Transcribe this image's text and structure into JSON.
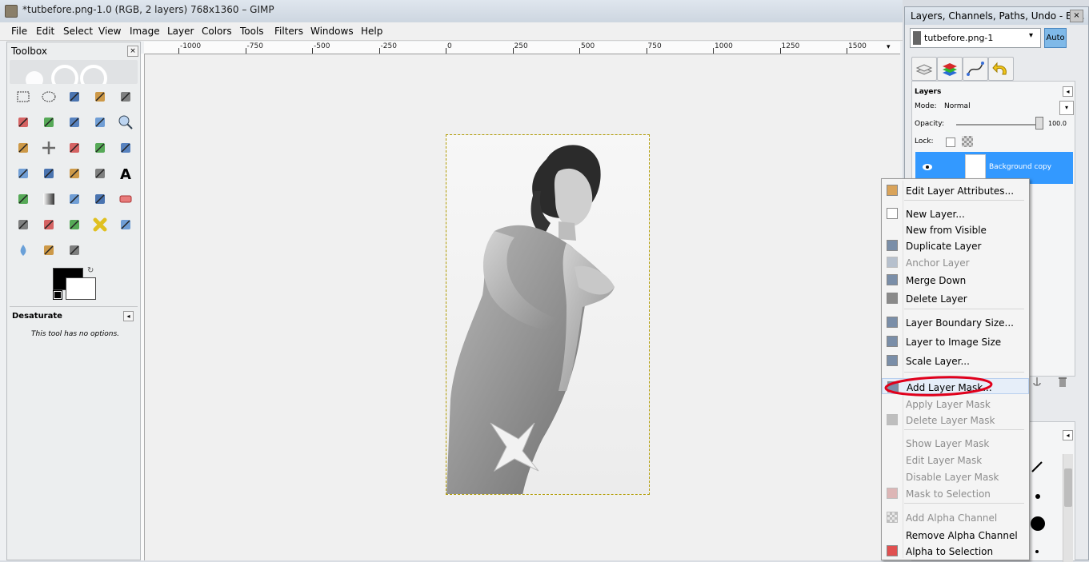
{
  "window": {
    "title": "*tutbefore.png-1.0 (RGB, 2 layers) 768x1360 – GIMP"
  },
  "menubar": [
    "File",
    "Edit",
    "Select",
    "View",
    "Image",
    "Layer",
    "Colors",
    "Tools",
    "Filters",
    "Windows",
    "Help"
  ],
  "toolbox": {
    "title": "Toolbox",
    "close_icon": "×",
    "tools": [
      "rect-select",
      "ellipse-select",
      "free-select",
      "fuzzy-select",
      "select-by-color",
      "scissors",
      "foreground-select",
      "paths",
      "color-picker",
      "zoom",
      "measure",
      "move",
      "align",
      "crop",
      "rotate",
      "scale",
      "shear",
      "perspective",
      "flip",
      "text",
      "bucket-fill",
      "blend",
      "pencil",
      "paintbrush",
      "eraser",
      "airbrush",
      "ink",
      "clone",
      "heal",
      "perspective-clone",
      "blur",
      "smudge",
      "dodge-burn"
    ],
    "fg_color": "#000000",
    "bg_color": "#ffffff",
    "swap_icon": "↻",
    "tool_options_title": "Desaturate",
    "tool_options_note": "This tool has no options.",
    "collapse_icon": "◂"
  },
  "ruler": {
    "labels": [
      "-1000",
      "-750",
      "-500",
      "-250",
      "0",
      "250",
      "500",
      "750",
      "1000",
      "1250",
      "1500"
    ],
    "corner_arrow": "▾"
  },
  "dock": {
    "title": "Layers, Channels, Paths, Undo - Br...",
    "close_icon": "×",
    "image_select": "tutbefore.png-1",
    "image_select_arrow": "▾",
    "auto_label": "Auto",
    "tabs": [
      "layers-tab",
      "channels-tab",
      "paths-tab",
      "undo-tab"
    ],
    "layers": {
      "label": "Layers",
      "collapse_icon": "◂",
      "mode_label": "Mode:",
      "mode_value": "Normal",
      "mode_arrow": "▾",
      "opacity_label": "Opacity:",
      "opacity_value": "100.0",
      "lock_label": "Lock:",
      "layer_name": "Background copy"
    },
    "brushes_collapse": "◂"
  },
  "context_menu": {
    "items": [
      {
        "label": "Edit Layer Attributes...",
        "disabled": false,
        "icon": "edit-attributes-icon"
      },
      {
        "label": "New Layer...",
        "disabled": false,
        "icon": "new-layer-icon"
      },
      {
        "label": "New from Visible",
        "disabled": false,
        "icon": ""
      },
      {
        "label": "Duplicate Layer",
        "disabled": false,
        "icon": "duplicate-layer-icon"
      },
      {
        "label": "Anchor Layer",
        "disabled": true,
        "icon": "anchor-icon"
      },
      {
        "label": "Merge Down",
        "disabled": false,
        "icon": "merge-down-icon"
      },
      {
        "label": "Delete Layer",
        "disabled": false,
        "icon": "delete-layer-icon"
      },
      {
        "label": "Layer Boundary Size...",
        "disabled": false,
        "icon": "boundary-size-icon"
      },
      {
        "label": "Layer to Image Size",
        "disabled": false,
        "icon": "layer-to-image-size-icon"
      },
      {
        "label": "Scale Layer...",
        "disabled": false,
        "icon": "scale-layer-icon"
      },
      {
        "label": "Add Layer Mask...",
        "disabled": false,
        "icon": "add-mask-icon"
      },
      {
        "label": "Apply Layer Mask",
        "disabled": true,
        "icon": ""
      },
      {
        "label": "Delete Layer Mask",
        "disabled": true,
        "icon": "delete-mask-icon"
      },
      {
        "label": "Show Layer Mask",
        "disabled": true,
        "icon": ""
      },
      {
        "label": "Edit Layer Mask",
        "disabled": true,
        "icon": ""
      },
      {
        "label": "Disable Layer Mask",
        "disabled": true,
        "icon": ""
      },
      {
        "label": "Mask to Selection",
        "disabled": true,
        "icon": "mask-to-selection-icon"
      },
      {
        "label": "Add Alpha Channel",
        "disabled": true,
        "icon": "add-alpha-icon"
      },
      {
        "label": "Remove Alpha Channel",
        "disabled": false,
        "icon": ""
      },
      {
        "label": "Alpha to Selection",
        "disabled": false,
        "icon": "alpha-to-selection-icon"
      }
    ]
  },
  "colors": {
    "selection_blue": "#3399ff",
    "annotation_red": "#e0001b"
  }
}
